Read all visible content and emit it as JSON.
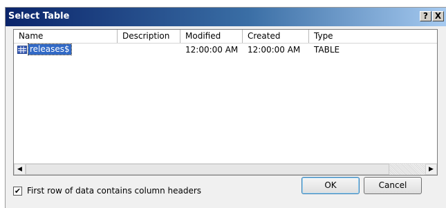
{
  "dialog": {
    "title": "Select Table",
    "help_button": "?",
    "close_button": "X"
  },
  "table": {
    "columns": [
      "Name",
      "Description",
      "Modified",
      "Created",
      "Type"
    ],
    "rows": [
      {
        "name": "releases$",
        "description": "",
        "modified": "12:00:00 AM",
        "created": "12:00:00 AM",
        "type": "TABLE",
        "icon": "table-icon",
        "selected": true
      }
    ]
  },
  "scrollbar": {
    "left_arrow": "◀",
    "right_arrow": "▶"
  },
  "options": {
    "first_row_headers_label": "First row of data contains column headers",
    "first_row_headers_checked": true,
    "check_glyph": "✔"
  },
  "buttons": {
    "ok": "OK",
    "cancel": "Cancel"
  }
}
